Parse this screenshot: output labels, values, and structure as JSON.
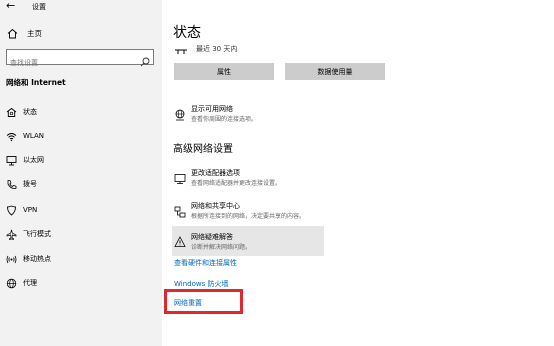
{
  "window": {
    "title": "设置",
    "back_glyph": "←"
  },
  "sidebar": {
    "home_label": "主页",
    "search_placeholder": "查找设置",
    "section_title": "网络和 Internet",
    "items": [
      {
        "label": "状态",
        "icon": "home-globe-icon"
      },
      {
        "label": "WLAN",
        "icon": "wifi-icon"
      },
      {
        "label": "以太网",
        "icon": "ethernet-icon"
      },
      {
        "label": "拨号",
        "icon": "phone-icon"
      },
      {
        "label": "VPN",
        "icon": "vpn-icon"
      },
      {
        "label": "飞行模式",
        "icon": "airplane-icon"
      },
      {
        "label": "移动热点",
        "icon": "hotspot-icon"
      },
      {
        "label": "代理",
        "icon": "globe-icon"
      }
    ]
  },
  "main": {
    "title": "状态",
    "status_text": "最近 30 天内",
    "buttons": {
      "properties": "属性",
      "data_usage": "数据使用量"
    },
    "available_networks": {
      "title": "显示可用网络",
      "desc": "查看你周围的连接选项。"
    },
    "advanced_title": "高级网络设置",
    "adapter_options": {
      "title": "更改适配器选项",
      "desc": "查看网络适配器并更改连接设置。"
    },
    "sharing_center": {
      "title": "网络和共享中心",
      "desc": "根据所连接到的网络，决定要共享的内容。"
    },
    "troubleshooter": {
      "title": "网络疑难解答",
      "desc": "诊断并解决网络问题。"
    },
    "links": {
      "hardware": "查看硬件和连接属性",
      "firewall": "Windows 防火墙",
      "reset": "网络重置"
    }
  },
  "colors": {
    "accent": "#0067c0",
    "highlight_box": "#e0282e",
    "sidebar_bg": "#f2f2f2"
  }
}
